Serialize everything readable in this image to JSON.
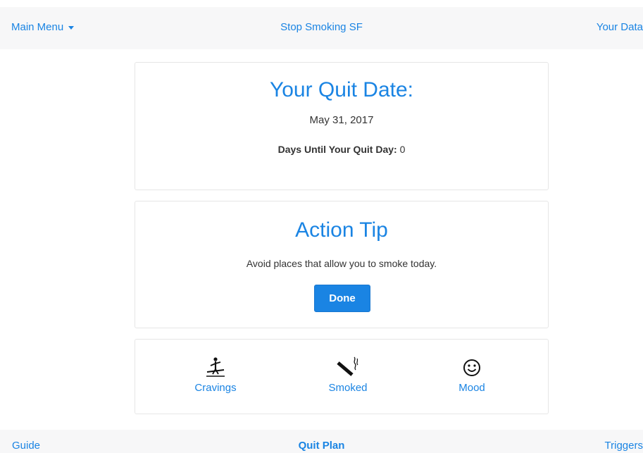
{
  "topbar": {
    "main_menu": "Main Menu",
    "title": "Stop Smoking SF",
    "your_data": "Your Data"
  },
  "quit_card": {
    "title": "Your Quit Date:",
    "date": "May 31, 2017",
    "days_label": "Days Until Your Quit Day:",
    "days_value": "0"
  },
  "tip_card": {
    "title": "Action Tip",
    "text": "Avoid places that allow you to smoke today.",
    "done_label": "Done"
  },
  "trackers": {
    "cravings": "Cravings",
    "smoked": "Smoked",
    "mood": "Mood"
  },
  "bottombar": {
    "guide": "Guide",
    "quit_plan": "Quit Plan",
    "triggers": "Triggers"
  },
  "colors": {
    "accent": "#1a84e3",
    "text": "#333333",
    "bar_bg": "#f7f7f8"
  }
}
